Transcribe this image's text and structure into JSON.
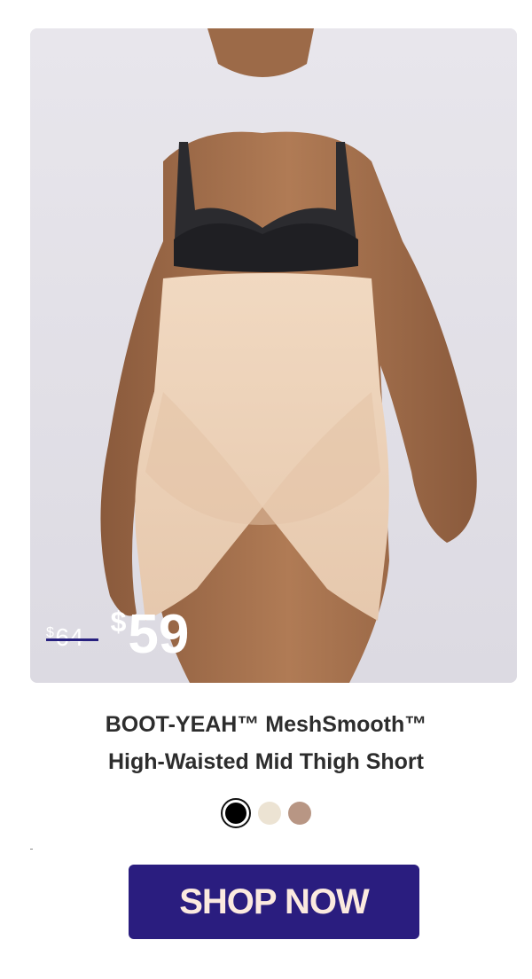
{
  "product": {
    "old_price_currency": "$",
    "old_price_amount": "64",
    "new_price_currency": "$",
    "new_price_amount": "59",
    "title_line1": "BOOT-YEAH™ MeshSmooth™",
    "title_line2": "High-Waisted Mid Thigh Short"
  },
  "swatches": [
    {
      "name": "black",
      "color": "#000000",
      "selected": true
    },
    {
      "name": "nude",
      "color": "#ece3d3",
      "selected": false
    },
    {
      "name": "mocha",
      "color": "#b89684",
      "selected": false
    }
  ],
  "cta": {
    "label": "SHOP NOW",
    "background": "#2a1d7f",
    "text_color": "#fbeadf"
  },
  "colors": {
    "strike_line": "#27207f",
    "title_text": "#2d2d2d",
    "image_background": "#e2e0e7"
  }
}
